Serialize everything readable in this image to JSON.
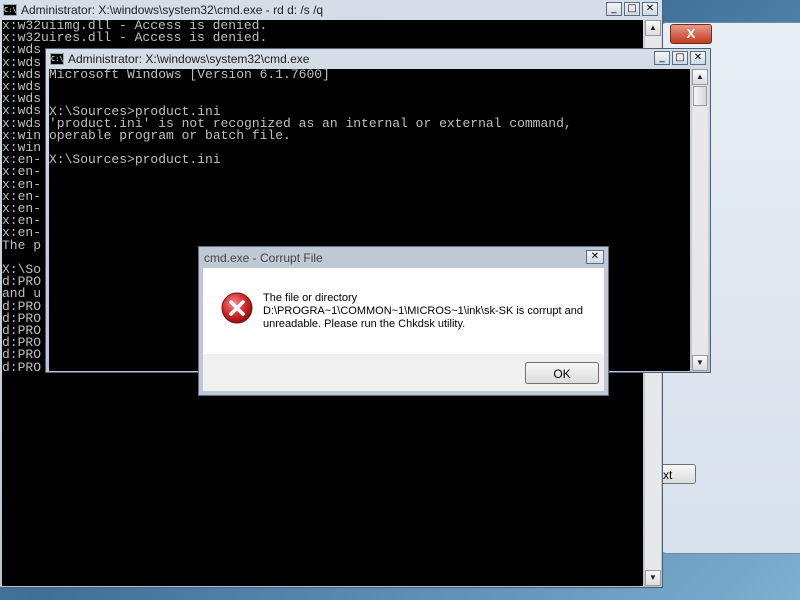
{
  "setup_window": {
    "close_label": "X",
    "next_label": "xt"
  },
  "bg_window": {
    "icon_text": "C:\\",
    "title": "Administrator: X:\\windows\\system32\\cmd.exe - rd  d: /s /q",
    "minimize": "_",
    "maximize": "□",
    "close": "✕",
    "lines": [
      "x:w32uiimg.dll - Access is denied.",
      "x:w32uires.dll - Access is denied.",
      "x:wds",
      "x:wds",
      "x:wds",
      "x:wds",
      "x:wds",
      "x:wds",
      "x:wds",
      "x:win",
      "x:win",
      "x:en-",
      "x:en-",
      "x:en-",
      "x:en-",
      "x:en-",
      "x:en-",
      "x:en-",
      "The p",
      "",
      "X:\\So",
      "d:PRO",
      "and u",
      "d:PRO",
      "d:PRO",
      "d:PRO",
      "d:PRO",
      "d:PRO",
      "d:PRO"
    ]
  },
  "fg_window": {
    "icon_text": "C:\\",
    "title": "Administrator: X:\\windows\\system32\\cmd.exe",
    "minimize": "_",
    "maximize": "□",
    "close": "✕",
    "lines": [
      "Microsoft Windows [Version 6.1.7600]",
      "",
      "",
      "X:\\Sources>product.ini",
      "'product.ini' is not recognized as an internal or external command,",
      "operable program or batch file.",
      "",
      "X:\\Sources>product.ini"
    ]
  },
  "dialog": {
    "title": "cmd.exe - Corrupt File",
    "close": "✕",
    "message_line1": "The file or directory",
    "message_line2": "D:\\PROGRA~1\\COMMON~1\\MICROS~1\\ink\\sk-SK is corrupt and",
    "message_line3": "unreadable. Please run the Chkdsk utility.",
    "ok_label": "OK"
  },
  "colors": {
    "console_bg": "#000000",
    "console_text": "#c0c0c0",
    "error_red": "#d62828"
  }
}
